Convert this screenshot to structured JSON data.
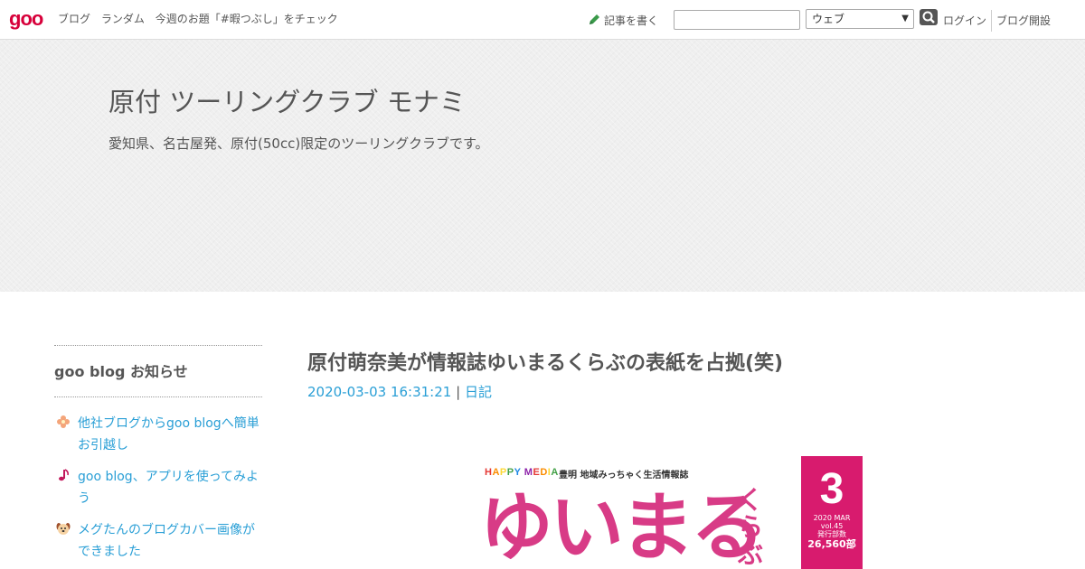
{
  "topbar": {
    "logo": "goo",
    "nav": [
      "ブログ",
      "ランダム",
      "今週のお題「#暇つぶし」をチェック"
    ],
    "write_label": "記事を書く",
    "search_value": "",
    "search_scope": "ウェブ",
    "login_label": "ログイン",
    "open_blog_label": "ブログ開設"
  },
  "header": {
    "title": "原付 ツーリングクラブ モナミ",
    "description": "愛知県、名古屋発、原付(50cc)限定のツーリングクラブです。"
  },
  "sidebar": {
    "heading": "goo blog お知らせ",
    "items": [
      {
        "icon": "sparkle-icon",
        "label": "他社ブログからgoo blogへ簡単お引越し"
      },
      {
        "icon": "music-note-icon",
        "label": "goo blog、アプリを使ってみよう"
      },
      {
        "icon": "dog-face-icon",
        "label": "メグたんのブログカバー画像ができました"
      }
    ]
  },
  "post": {
    "title": "原付萌奈美が情報誌ゆいまるくらぶの表紙を占拠(笑)",
    "datetime": "2020-03-03 16:31:21",
    "separator": "|",
    "category": "日記"
  },
  "cover": {
    "brand": "HAPPY MEDIA",
    "subtitle": "豊明 地域みっちゃく生活情報誌",
    "logo": "ゆいまる",
    "logo_suffix": "くらぶ",
    "month": "3",
    "issue": "2020 MAR",
    "volume": "vol.45",
    "print_label": "発行部数",
    "count": "26,560部"
  },
  "colors": {
    "accent": "#d7003a",
    "link": "#2a9fd6",
    "magenta": "#d81b6e"
  }
}
